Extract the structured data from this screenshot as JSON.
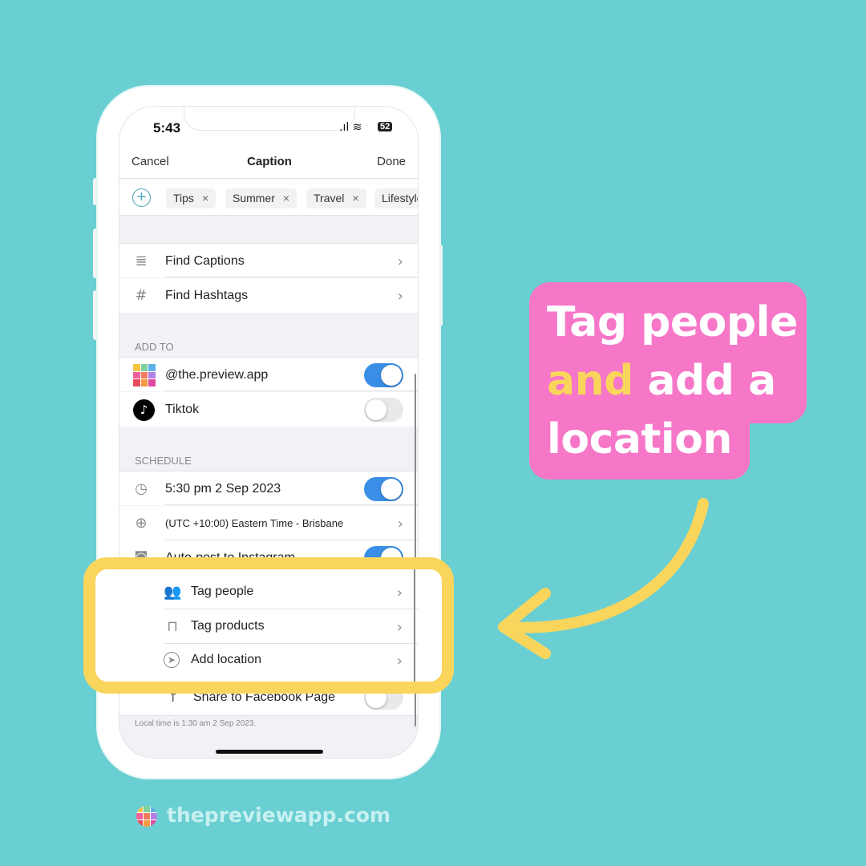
{
  "status_bar": {
    "time": "5:43",
    "battery": "52"
  },
  "nav": {
    "cancel": "Cancel",
    "title": "Caption",
    "done": "Done"
  },
  "tags": [
    {
      "label": "Tips"
    },
    {
      "label": "Summer"
    },
    {
      "label": "Travel"
    },
    {
      "label": "Lifestyle"
    }
  ],
  "tools": [
    {
      "label": "Find Captions",
      "icon": "text-lines-icon"
    },
    {
      "label": "Find Hashtags",
      "icon": "hashtag-icon"
    }
  ],
  "add_to": {
    "header": "ADD TO",
    "accounts": [
      {
        "label": "@the.preview.app",
        "enabled": true
      },
      {
        "label": "Tiktok",
        "enabled": false
      }
    ]
  },
  "schedule": {
    "header": "SCHEDULE",
    "datetime": "5:30 pm  2 Sep 2023",
    "datetime_enabled": true,
    "timezone": "(UTC +10:00) Eastern Time - Brisbane",
    "auto_post": "Auto-post to Instagram",
    "auto_post_enabled": true
  },
  "highlighted": [
    {
      "label": "Tag people",
      "icon": "people-icon"
    },
    {
      "label": "Tag products",
      "icon": "shopping-bag-icon"
    },
    {
      "label": "Add location",
      "icon": "location-arrow-icon"
    }
  ],
  "facebook": {
    "label": "Share to Facebook Page",
    "enabled": false
  },
  "footer_note": "Local time is 1:30 am  2 Sep 2023.",
  "callout": {
    "line1": "Tag people",
    "highlight": "and",
    "line2_rest": " add a",
    "line3": "location"
  },
  "brand": {
    "site": "thepreviewapp.com"
  },
  "colors": {
    "background": "#6ACFD2",
    "pink": "#F676C8",
    "yellow": "#FAD55C",
    "toggle_on": "#3A8EE6"
  }
}
